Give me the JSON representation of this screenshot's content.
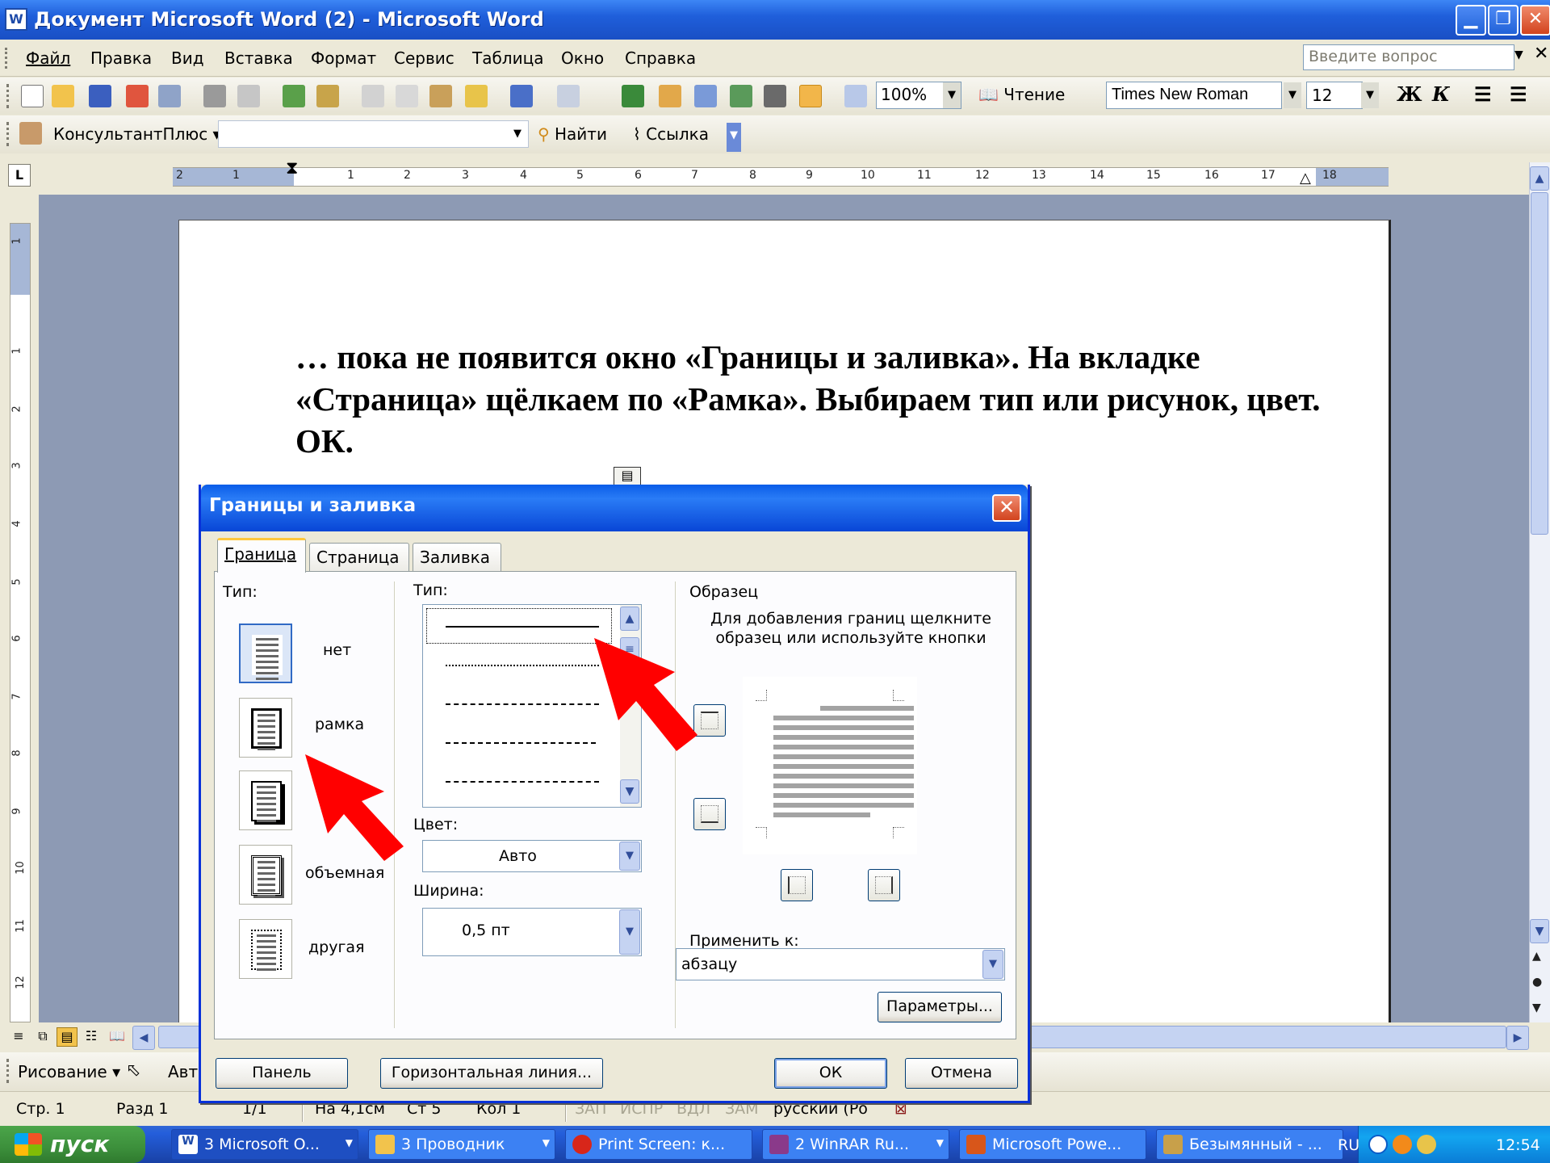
{
  "window": {
    "title": "Документ Microsoft Word (2) - Microsoft Word",
    "app_icon": "W"
  },
  "menu": {
    "items": [
      "Файл",
      "Правка",
      "Вид",
      "Вставка",
      "Формат",
      "Сервис",
      "Таблица",
      "Окно",
      "Справка"
    ],
    "ask_placeholder": "Введите вопрос"
  },
  "toolbar": {
    "zoom": "100%",
    "reading": "Чтение",
    "font": "Times New Roman",
    "size": "12",
    "bold": "Ж",
    "italic": "К"
  },
  "kp_toolbar": {
    "label": "КонсультантПлюс ▾",
    "find": "Найти",
    "link": "Ссылка"
  },
  "ruler": {
    "h_numbers": [
      "2",
      "1",
      "1",
      "2",
      "3",
      "4",
      "5",
      "6",
      "7",
      "8",
      "9",
      "10",
      "11",
      "12",
      "13",
      "14",
      "15",
      "16",
      "17",
      "18"
    ],
    "v_numbers": [
      "1",
      "1",
      "2",
      "3",
      "4",
      "5",
      "6",
      "7",
      "8",
      "9",
      "10",
      "11",
      "12"
    ]
  },
  "document": {
    "paragraph": "… пока не появится окно «Границы и заливка». На вкладке «Страница» щёлкаем по «Рамка». Выбираем тип или рисунок, цвет. ОК."
  },
  "dialog": {
    "title": "Границы и заливка",
    "tabs": [
      "Граница",
      "Страница",
      "Заливка"
    ],
    "type_label": "Тип:",
    "settings": [
      "нет",
      "рамка",
      "",
      "объемная",
      "другая"
    ],
    "style_label": "Тип:",
    "color_label": "Цвет:",
    "color_value": "Авто",
    "width_label": "Ширина:",
    "width_value": "0,5 пт",
    "preview_label": "Образец",
    "preview_hint": "Для добавления границ щелкните образец или используйте кнопки",
    "apply_label": "Применить к:",
    "apply_value": "абзацу",
    "params_button": "Параметры...",
    "panel_button": "Панель",
    "hline_button": "Горизонтальная линия...",
    "ok_button": "ОК",
    "cancel_button": "Отмена"
  },
  "drawing_bar": {
    "label": "Рисование ▾",
    "autoshapes": "Авт"
  },
  "status": {
    "page": "Стр. 1",
    "section": "Разд 1",
    "pages": "1/1",
    "at": "На 4,1см",
    "line": "Ст 5",
    "col": "Кол 1",
    "rec": "ЗАП",
    "trk": "ИСПР",
    "ext": "ВДЛ",
    "ovr": "ЗАМ",
    "lang": "русский (Ро"
  },
  "taskbar": {
    "start": "пуск",
    "tasks": [
      "3 Microsoft O...",
      "3 Проводник",
      "Print Screen: к...",
      "2 WinRAR Ru...",
      "Microsoft Powe...",
      "Безымянный - ..."
    ],
    "lang": "RU",
    "clock": "12:54"
  },
  "colors": {
    "title_blue": "#1f5fdb",
    "dialog_blue": "#0831d9",
    "arrow_red": "#ff0000",
    "start_green": "#3c8f3b"
  }
}
